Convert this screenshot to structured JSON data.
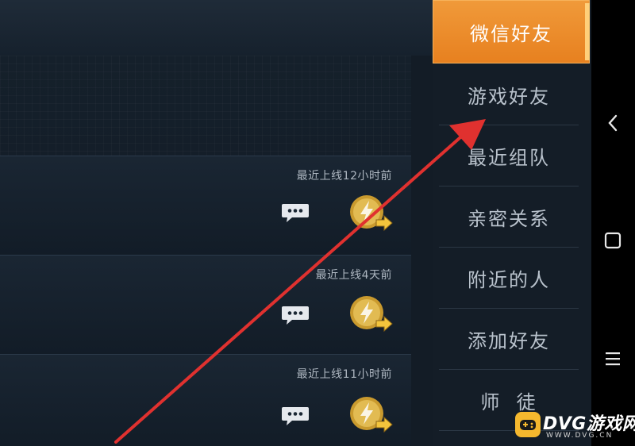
{
  "menu": {
    "items": [
      {
        "label": "微信好友",
        "active": true
      },
      {
        "label": "游戏好友",
        "active": false
      },
      {
        "label": "最近组队",
        "active": false
      },
      {
        "label": "亲密关系",
        "active": false
      },
      {
        "label": "附近的人",
        "active": false
      },
      {
        "label": "添加好友",
        "active": false
      },
      {
        "label": "师  徒",
        "active": false
      }
    ]
  },
  "friends": [
    {
      "status": "最近上线12小时前"
    },
    {
      "status": "最近上线4天前"
    },
    {
      "status": "最近上线11小时前"
    }
  ],
  "icons": {
    "chat": "chat-bubble-icon",
    "gift": "gold-coin-send-icon",
    "nav_back": "chevron-left-icon",
    "nav_home": "square-icon",
    "nav_menu": "hamburger-icon"
  },
  "colors": {
    "accent": "#e98523",
    "arrow": "#e0312f",
    "coin": "#d4a73a"
  },
  "watermark": {
    "main": "DVG游戏网",
    "sub": "WWW.DVG.CN"
  }
}
